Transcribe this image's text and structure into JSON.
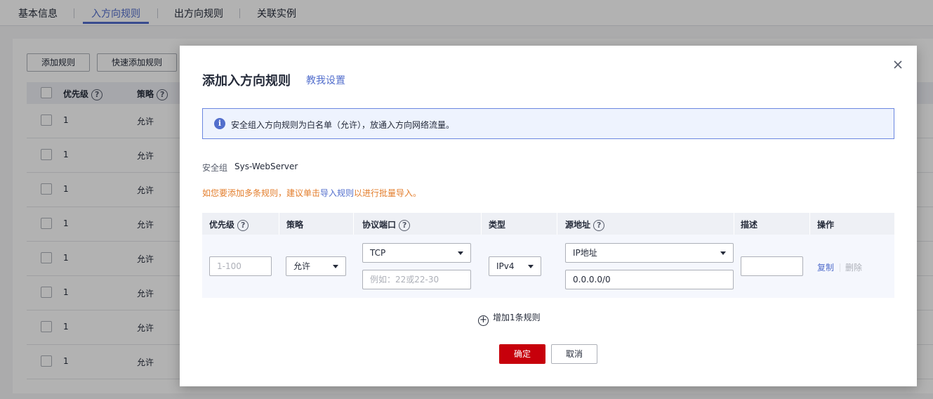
{
  "tabs": [
    "基本信息",
    "入方向规则",
    "出方向规则",
    "关联实例"
  ],
  "toolbar": {
    "add_rule": "添加规则",
    "quick_add_rule": "快速添加规则"
  },
  "bg_table": {
    "headers": {
      "priority": "优先级",
      "policy": "策略"
    },
    "rows": [
      {
        "priority": "1",
        "policy": "允许"
      },
      {
        "priority": "1",
        "policy": "允许"
      },
      {
        "priority": "1",
        "policy": "允许"
      },
      {
        "priority": "1",
        "policy": "允许"
      },
      {
        "priority": "1",
        "policy": "允许"
      },
      {
        "priority": "1",
        "policy": "允许"
      },
      {
        "priority": "1",
        "policy": "允许"
      },
      {
        "priority": "1",
        "policy": "允许"
      }
    ]
  },
  "dialog": {
    "title": "添加入方向规则",
    "guide_link": "教我设置",
    "close_icon": "×",
    "info_text": "安全组入方向规则为白名单（允许），放通入方向网络流量。",
    "security_group_label": "安全组",
    "security_group_value": "Sys-WebServer",
    "tip_prefix": "如您要添加多条规则，建议单击",
    "tip_link": "导入规则",
    "tip_suffix": "以进行批量导入。",
    "columns": {
      "priority": "优先级",
      "policy": "策略",
      "protocol_port": "协议端口",
      "type": "类型",
      "source": "源地址",
      "description": "描述",
      "actions": "操作"
    },
    "row": {
      "priority_placeholder": "1-100",
      "policy": "允许",
      "protocol": "TCP",
      "port_placeholder": "例如：22或22-30",
      "type": "IPv4",
      "source_type": "IP地址",
      "source_value": "0.0.0.0/0",
      "description": "",
      "copy": "复制",
      "delete": "删除"
    },
    "add_rule": "增加1条规则",
    "confirm": "确定",
    "cancel": "取消"
  },
  "colors": {
    "accent": "#526ecc",
    "primary_button": "#c7000b",
    "warning_text": "#e37d2b"
  }
}
